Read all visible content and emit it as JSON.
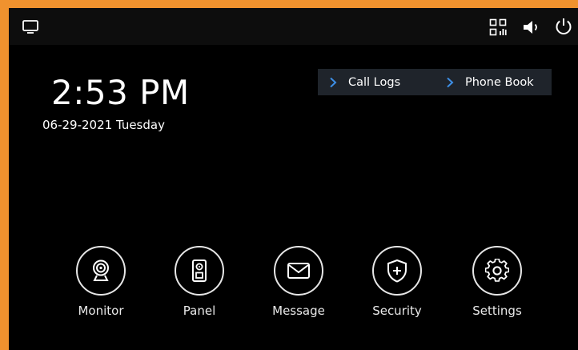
{
  "status_bar": {
    "left_icon": "monitor-screen-icon",
    "right_icons": [
      "qr-code-icon",
      "volume-icon",
      "power-icon"
    ]
  },
  "clock": {
    "time": "2:53 PM",
    "date": "06-29-2021 Tuesday"
  },
  "quick_links": [
    {
      "label": "Call Logs",
      "icon": "chevron-right-icon"
    },
    {
      "label": "Phone Book",
      "icon": "chevron-right-icon"
    }
  ],
  "menu": [
    {
      "label": "Monitor",
      "icon": "webcam-icon"
    },
    {
      "label": "Panel",
      "icon": "door-panel-icon"
    },
    {
      "label": "Message",
      "icon": "envelope-icon"
    },
    {
      "label": "Security",
      "icon": "shield-plus-icon"
    },
    {
      "label": "Settings",
      "icon": "gear-icon"
    }
  ],
  "colors": {
    "frame_border": "#f0922e",
    "background": "#000000",
    "quick_links_bg": "#1f242b",
    "chevron_accent": "#3d8fe6"
  }
}
